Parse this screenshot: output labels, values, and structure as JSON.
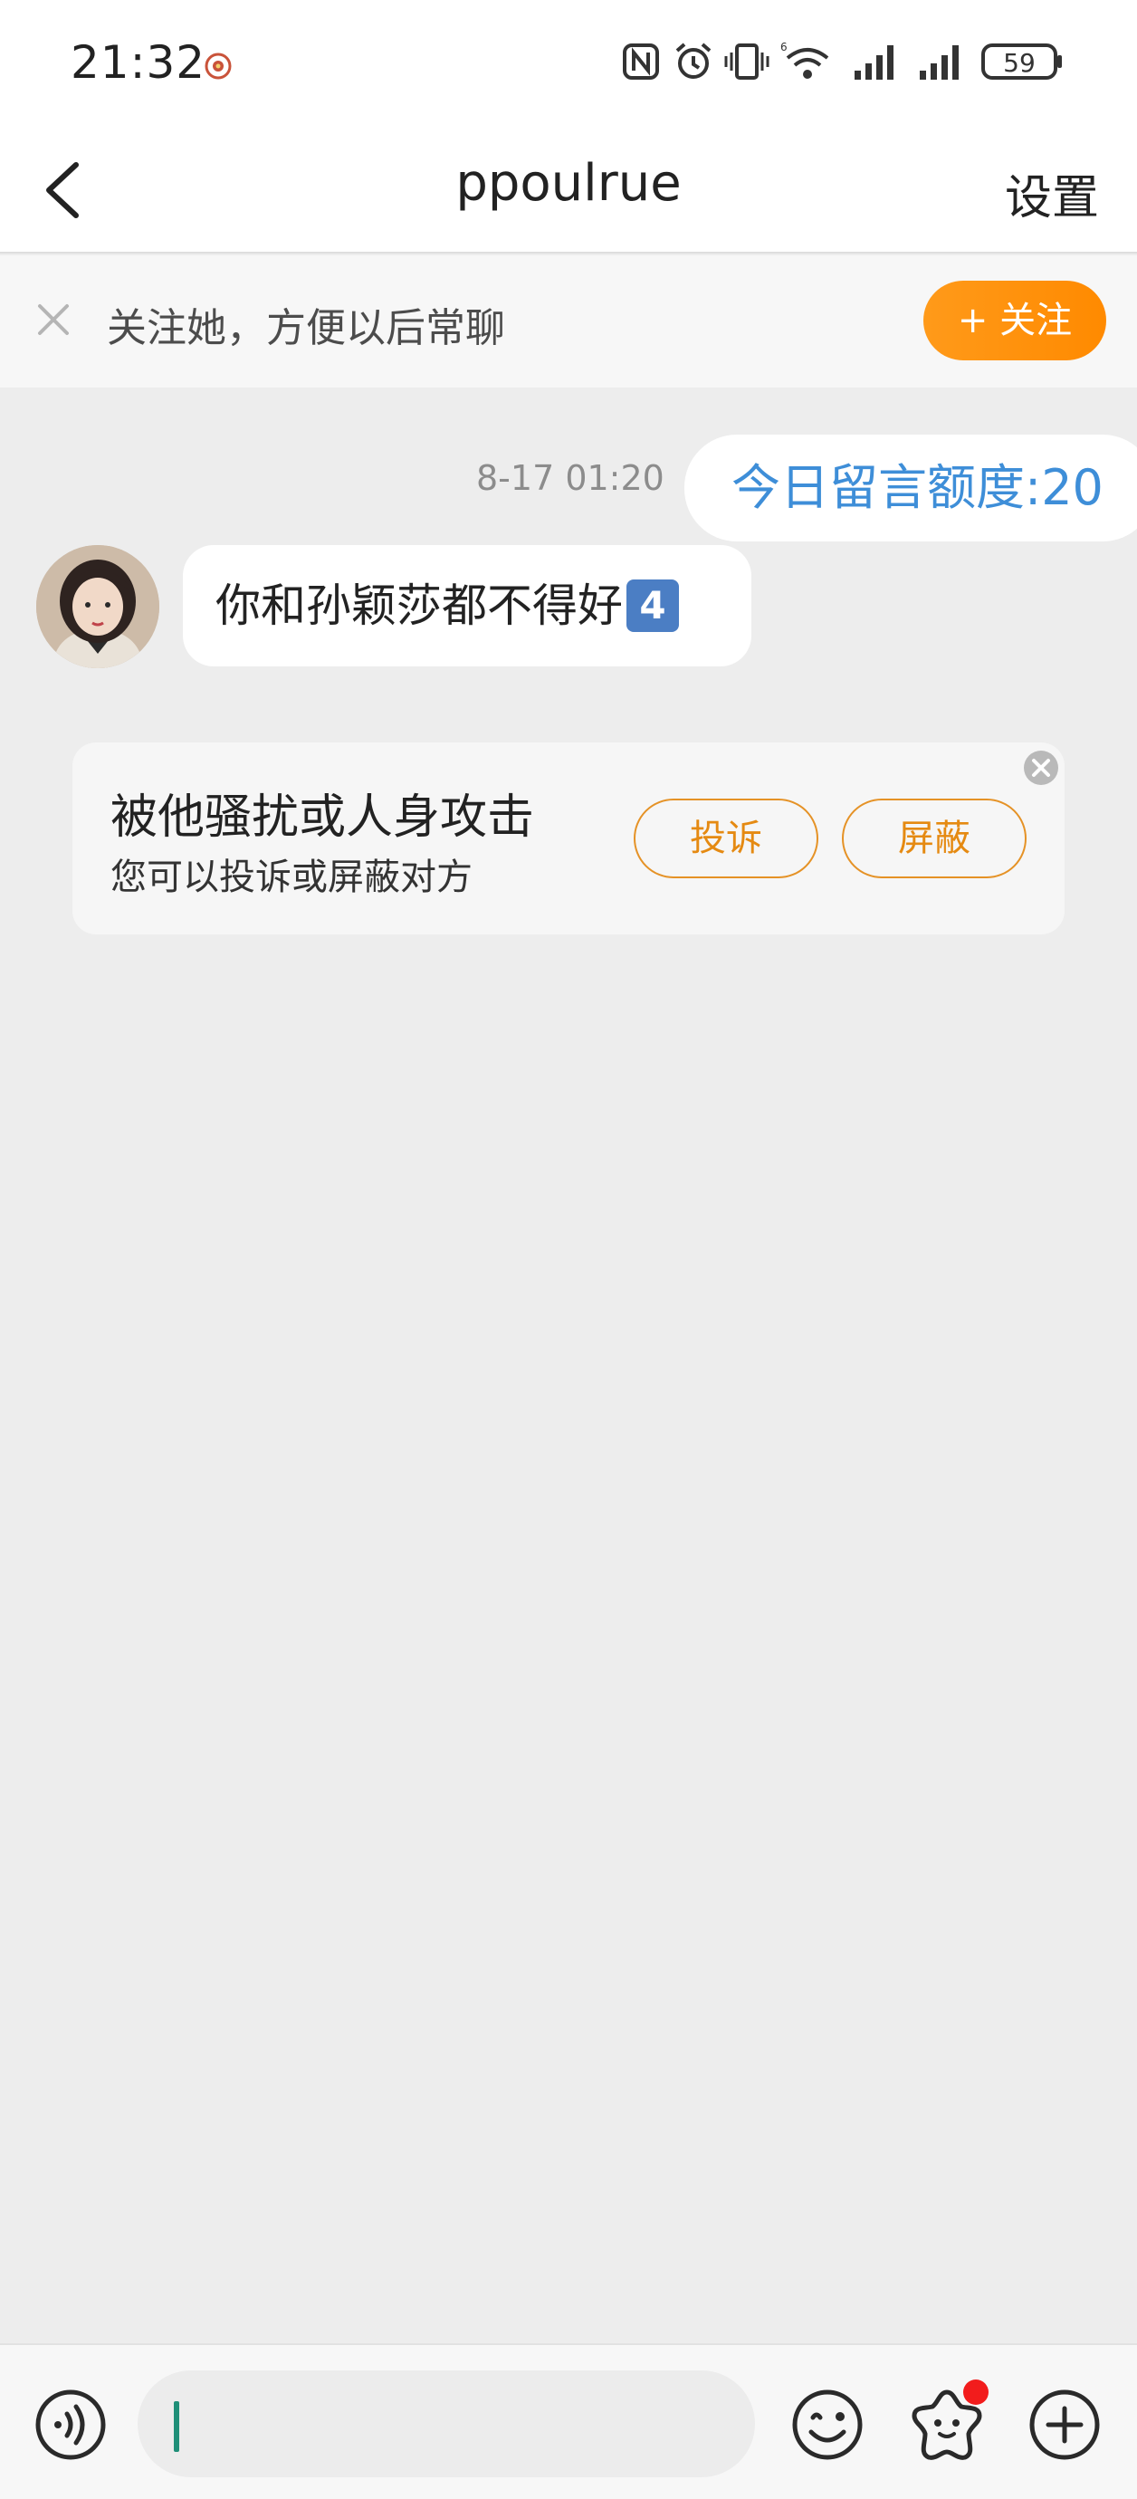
{
  "status_bar": {
    "time": "21:32",
    "battery": "59"
  },
  "header": {
    "title": "ppoulrue",
    "settings_label": "设置"
  },
  "follow_banner": {
    "text": "关注她，方便以后常聊",
    "follow_label": "+ 关注"
  },
  "messages": {
    "timestamp": "8-17 01:20",
    "quota_text": "今日留言额度:20",
    "received_text": "你和孙颖莎都不得好",
    "received_badge": "4"
  },
  "notice": {
    "title": "被他骚扰或人身攻击",
    "subtitle": "您可以投诉或屏蔽对方",
    "report_label": "投诉",
    "block_label": "屏蔽"
  },
  "input_bar": {
    "placeholder": ""
  },
  "colors": {
    "accent_orange": "#ff8a00",
    "quota_blue": "#3e8ed8",
    "background": "#ededed"
  }
}
